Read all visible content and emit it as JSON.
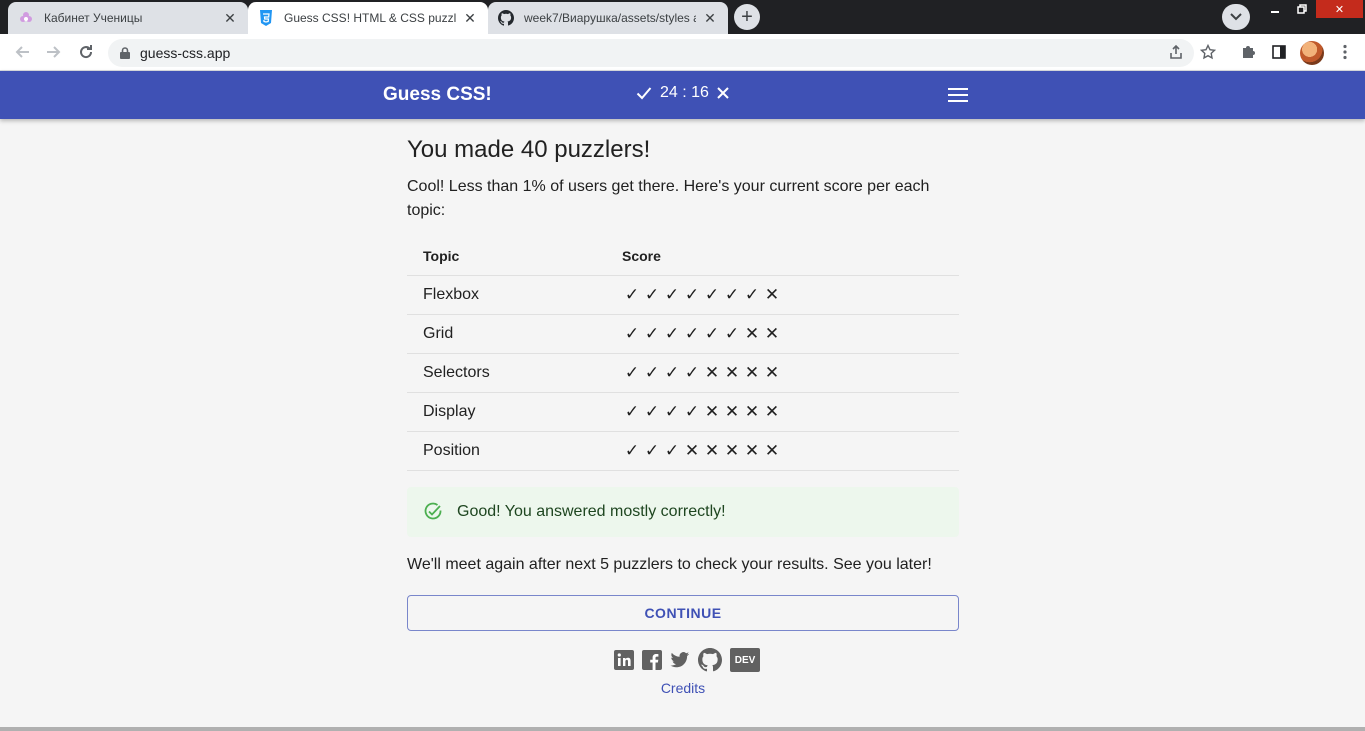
{
  "browser": {
    "tabs": [
      {
        "title": "Кабинет Ученицы",
        "favicon": "flower-favicon",
        "state": "inactive"
      },
      {
        "title": "Guess CSS! HTML & CSS puzzler",
        "favicon": "css3-favicon",
        "state": "active"
      },
      {
        "title": "week7/Виарушка/assets/styles at",
        "favicon": "github-favicon",
        "state": "inactive"
      }
    ],
    "url": "guess-css.app"
  },
  "app": {
    "brand": "Guess CSS!",
    "score": "24 : 16",
    "accent_color": "#3f51b5"
  },
  "results": {
    "heading": "You made 40 puzzlers!",
    "lead": "Cool! Less than 1% of users get there. Here's your current score per each topic:",
    "columns": [
      "Topic",
      "Score"
    ],
    "rows": [
      {
        "topic": "Flexbox",
        "marks": [
          "✓",
          "✓",
          "✓",
          "✓",
          "✓",
          "✓",
          "✓",
          "✕"
        ]
      },
      {
        "topic": "Grid",
        "marks": [
          "✓",
          "✓",
          "✓",
          "✓",
          "✓",
          "✓",
          "✕",
          "✕"
        ]
      },
      {
        "topic": "Selectors",
        "marks": [
          "✓",
          "✓",
          "✓",
          "✓",
          "✕",
          "✕",
          "✕",
          "✕"
        ]
      },
      {
        "topic": "Display",
        "marks": [
          "✓",
          "✓",
          "✓",
          "✓",
          "✕",
          "✕",
          "✕",
          "✕"
        ]
      },
      {
        "topic": "Position",
        "marks": [
          "✓",
          "✓",
          "✓",
          "✕",
          "✕",
          "✕",
          "✕",
          "✕"
        ]
      }
    ],
    "alert": "Good! You answered mostly correctly!",
    "outro": "We'll meet again after next 5 puzzlers to check your results. See you later!",
    "continue_label": "CONTINUE",
    "social": [
      "linkedin-icon",
      "facebook-icon",
      "twitter-icon",
      "github-icon",
      "dev-icon"
    ],
    "dev_label": "DEV",
    "credits": "Credits"
  }
}
